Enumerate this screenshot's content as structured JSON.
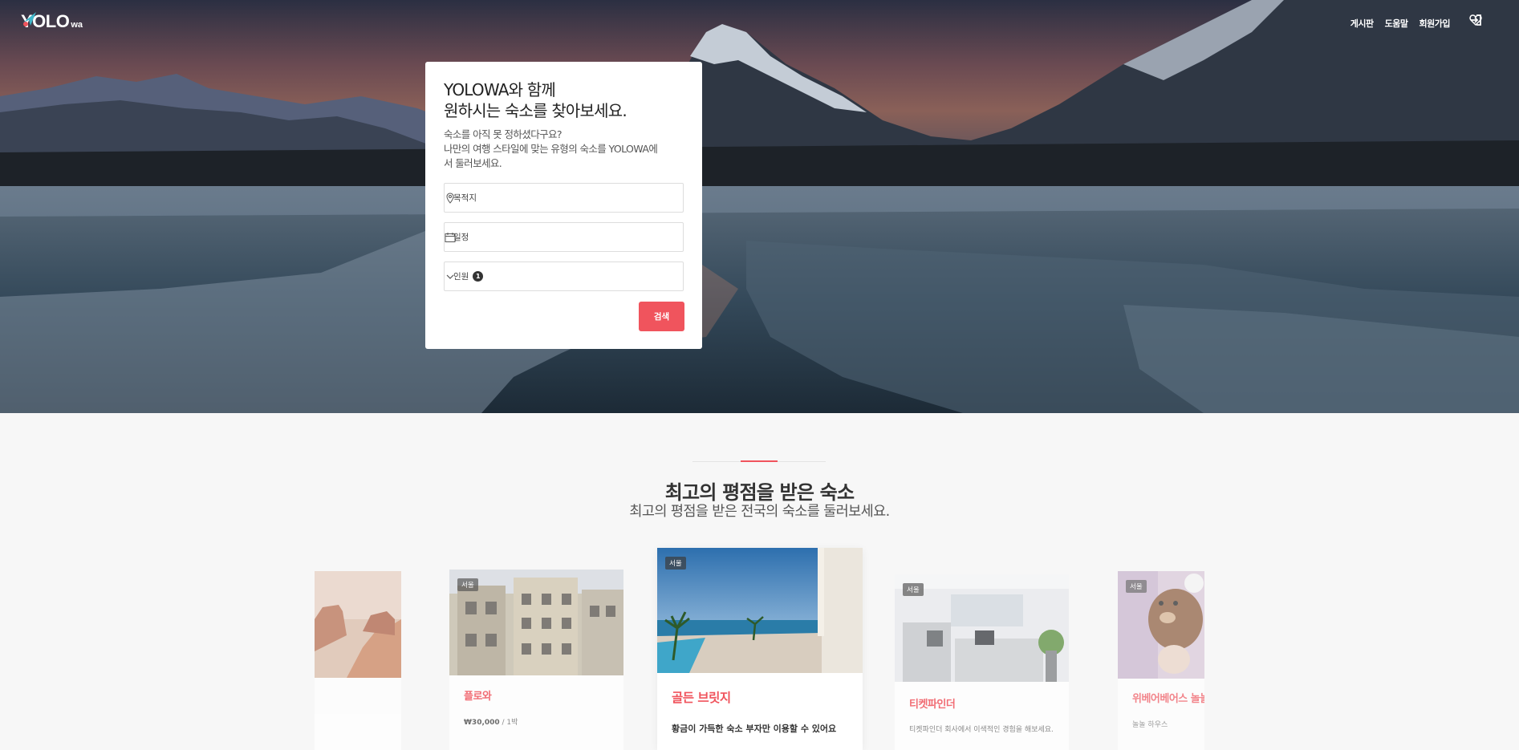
{
  "brand": {
    "logo_text": "YOLO",
    "logo_sub": "wa"
  },
  "nav": {
    "items": [
      "게시판",
      "도움말",
      "회원가입"
    ],
    "icons": [
      "login-icon",
      "heart-icon"
    ]
  },
  "search": {
    "title_line1": "YOLOWA와 함께",
    "title_line2": "원하시는 숙소를 찾아보세요.",
    "desc_line1": "숙소를 아직 못 정하셨다구요?",
    "desc_line2": "나만의 여행 스타일에 맞는 유형의 숙소를 YOLOWA에",
    "desc_line3": "서 둘러보세요.",
    "destination_label": "목적지",
    "schedule_label": "일정",
    "guests_label": "인원",
    "guests_count": "1",
    "button_label": "검색",
    "accent": "#f0545d"
  },
  "section": {
    "title": "최고의 평점을 받은 숙소",
    "subtitle": "최고의 평점을 받은 전국의 숙소를 둘러보세요."
  },
  "cards": [
    {
      "tag": "",
      "name": "",
      "meta": ""
    },
    {
      "tag": "서울",
      "name": "플로와",
      "price": "₩30,000",
      "unit": " / 1박"
    },
    {
      "tag": "서울",
      "name": "골든 브릿지",
      "meta": "황금이 가득한 숙소 부자만 이용할 수 있어요"
    },
    {
      "tag": "서울",
      "name": "티켓파인더",
      "meta": "티켓파인더 회사에서 이색적인 경험을 해보세요."
    },
    {
      "tag": "서울",
      "name": "위베어베어스 놀놀",
      "meta": "놀놀 하우스"
    }
  ]
}
